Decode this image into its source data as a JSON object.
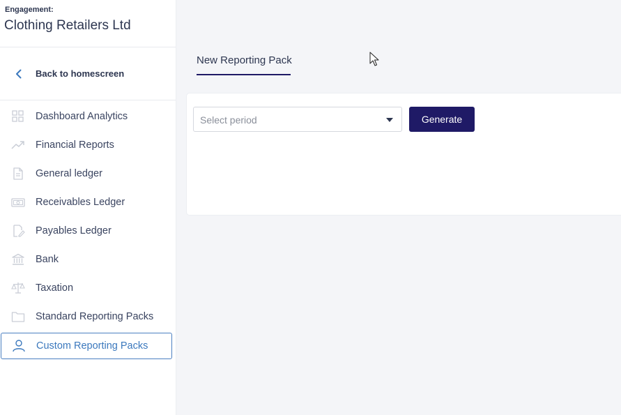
{
  "sidebar": {
    "engagement_label": "Engagement:",
    "engagement_name": "Clothing Retailers Ltd",
    "back_label": "Back to homescreen",
    "items": [
      {
        "label": "Dashboard Analytics",
        "icon": "grid-icon"
      },
      {
        "label": "Financial Reports",
        "icon": "trending-up-icon"
      },
      {
        "label": "General ledger",
        "icon": "document-icon"
      },
      {
        "label": "Receivables Ledger",
        "icon": "banknote-icon"
      },
      {
        "label": "Payables Ledger",
        "icon": "edit-document-icon"
      },
      {
        "label": "Bank",
        "icon": "bank-icon"
      },
      {
        "label": "Taxation",
        "icon": "scales-icon"
      },
      {
        "label": "Standard Reporting Packs",
        "icon": "folder-icon"
      },
      {
        "label": "Custom Reporting Packs",
        "icon": "user-icon",
        "active": true
      }
    ]
  },
  "main": {
    "tab_label": "New Reporting Pack",
    "period_select": {
      "placeholder": "Select period"
    },
    "generate_label": "Generate"
  },
  "colors": {
    "accent": "#1f1a66",
    "active_border": "#4a7fc1",
    "active_text": "#3b78bd",
    "background": "#f4f5f8"
  }
}
